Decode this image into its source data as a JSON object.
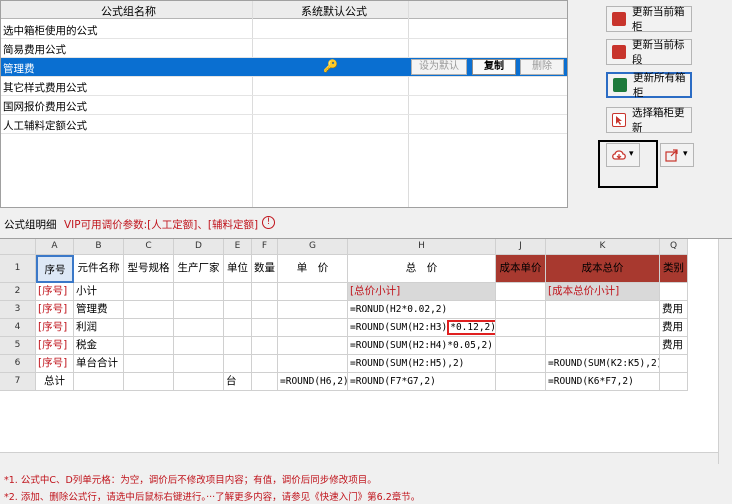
{
  "top_table": {
    "col_name_header": "公式组名称",
    "col_formula_header": "系统默认公式",
    "rows": [
      {
        "name": "选中箱柜使用的公式"
      },
      {
        "name": "简易费用公式"
      },
      {
        "name": "管理费"
      },
      {
        "name": "其它样式费用公式"
      },
      {
        "name": "国网报价费用公式"
      },
      {
        "name": "人工辅料定额公式"
      }
    ],
    "set_default_label": "设为默认",
    "copy_label": "复制",
    "delete_label": "删除"
  },
  "actions": {
    "update_current_cabinet": "更新当前箱柜",
    "update_current_section": "更新当前标段",
    "update_all_cabinets": "更新所有箱柜",
    "select_cabinet_update": "选择箱柜更新",
    "cloud_dropdown": "▾",
    "share_dropdown": "▾"
  },
  "detail": {
    "label": "公式组明细",
    "vip_note": "VIP可用调价参数:[人工定额]、[辅料定额]",
    "info_icon": "!"
  },
  "sheet": {
    "col_letters": [
      "A",
      "B",
      "C",
      "D",
      "E",
      "F",
      "G",
      "H",
      "J",
      "K",
      "Q"
    ],
    "row_numbers": [
      "1",
      "2",
      "3",
      "4",
      "5",
      "6",
      "7"
    ],
    "headers": [
      "序号",
      "元件名称",
      "型号规格",
      "生产厂家",
      "单位",
      "数量",
      "单　价",
      "总　价",
      "成本单价",
      "成本总价",
      "类别"
    ],
    "rows": [
      {
        "a": "[序号]",
        "b": "小计",
        "e": "",
        "g": "",
        "h": "[总价小计]",
        "k": "[成本总价小计]",
        "q": ""
      },
      {
        "a": "[序号]",
        "b": "管理费",
        "e": "",
        "g": "",
        "h": "=RONUD(H2*0.02,2)",
        "k": "",
        "q": "费用"
      },
      {
        "a": "[序号]",
        "b": "利润",
        "e": "",
        "g": "",
        "h": "=ROUND(SUM(H2:H3)",
        "h2": "*0.12,2)",
        "k": "",
        "q": "费用"
      },
      {
        "a": "[序号]",
        "b": "税金",
        "e": "",
        "g": "",
        "h": "=ROUND(SUM(H2:H4)*0.05,2)",
        "k": "",
        "q": "费用"
      },
      {
        "a": "[序号]",
        "b": "单台合计",
        "e": "",
        "g": "",
        "h": "=ROUND(SUM(H2:H5),2)",
        "k": "=ROUND(SUM(K2:K5),2)",
        "q": ""
      },
      {
        "a": "总计",
        "b": "",
        "e": "台",
        "g": "=ROUND(H6,2)",
        "h": "=ROUND(F7*G7,2)",
        "k": "=ROUND(K6*F7,2)",
        "q": ""
      }
    ]
  },
  "notes": [
    "*1. 公式中C、D列单元格：为空，调价后不修改项目内容；有值，调价后同步修改项目。",
    "*2. 添加、删除公式行，请选中后鼠标右键进行。···了解更多内容，请参见《快速入门》第6.2章节。"
  ],
  "colors": {
    "selection": "#0a6fd1",
    "header_red": "#a8392f",
    "note_red": "#c0141c"
  }
}
